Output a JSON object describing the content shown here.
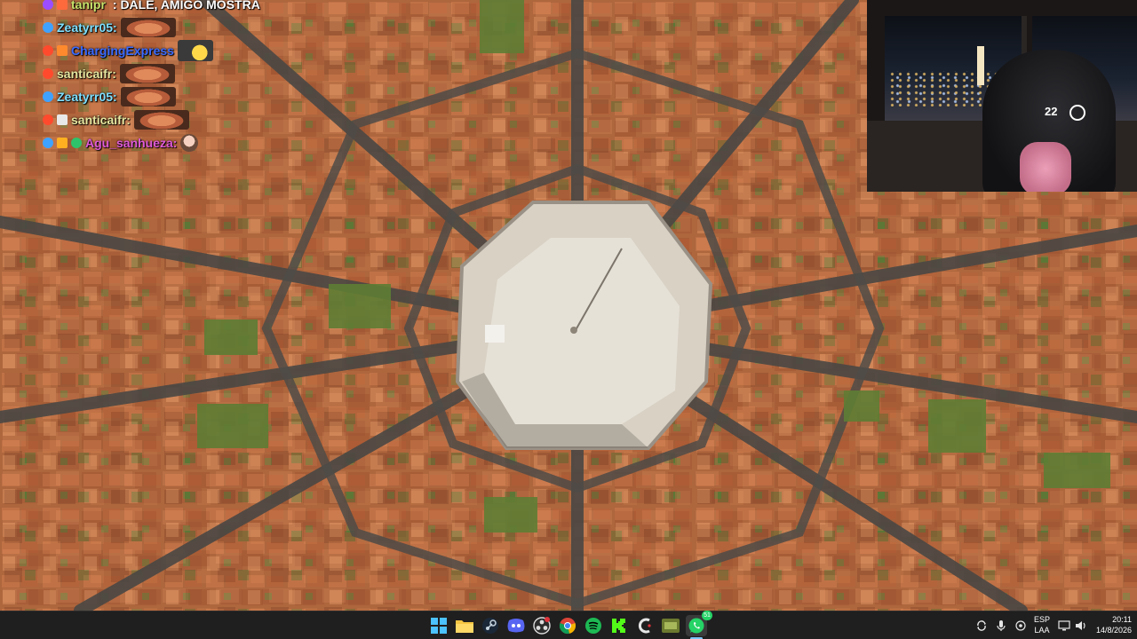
{
  "chat": {
    "messages": [
      {
        "user": "tanipr",
        "user_color": "#c7e36b",
        "message": ": DALE, AMIGO MOSTRA",
        "badges": [
          "#9b4dff",
          "#ff6a3d"
        ],
        "emote": "none"
      },
      {
        "user": "Zeatyrr05:",
        "user_color": "#7ee0ff",
        "message": "",
        "badges": [
          "#3fa2ff"
        ],
        "emote": "face"
      },
      {
        "user": "ChargingExpress",
        "user_color": "#3a6bff",
        "message": "",
        "badges": [
          "#ff4a2e",
          "#ff8a2e"
        ],
        "emote": "smiley"
      },
      {
        "user": "santicaifr:",
        "user_color": "#e7e7a0",
        "message": "",
        "badges": [
          "#ff4a2e"
        ],
        "emote": "face"
      },
      {
        "user": "Zeatyrr05:",
        "user_color": "#7ee0ff",
        "message": "",
        "badges": [
          "#3fa2ff"
        ],
        "emote": "face"
      },
      {
        "user": "santicaifr:",
        "user_color": "#e7e7a0",
        "message": "",
        "badges": [
          "#ff4a2e",
          "#e8e8e8"
        ],
        "emote": "face"
      },
      {
        "user": "Agu_sanhueza:",
        "user_color": "#e05ad8",
        "message": "",
        "badges": [
          "#3fa2ff",
          "#ffb020",
          "#2ec36a"
        ],
        "emote": "small"
      }
    ]
  },
  "webcam": {
    "cap_text": "22"
  },
  "taskbar": {
    "apps": [
      {
        "name": "start-button",
        "color": "#3aa0ff"
      },
      {
        "name": "file-explorer-icon",
        "color": "#f2c23a"
      },
      {
        "name": "steam-icon",
        "color": "#1b3a5c"
      },
      {
        "name": "discord-icon",
        "color": "#5865f2"
      },
      {
        "name": "obs-icon",
        "color": "#3a3a3a"
      },
      {
        "name": "chrome-icon",
        "color": "#e04a3a"
      },
      {
        "name": "spotify-icon",
        "color": "#1db954"
      },
      {
        "name": "kick-icon",
        "color": "#53fc18"
      },
      {
        "name": "ccleaner-icon",
        "color": "#d8d8d8"
      },
      {
        "name": "game-icon",
        "color": "#6a7a3a"
      },
      {
        "name": "whatsapp-icon",
        "color": "#25d366"
      }
    ],
    "whatsapp_badge": "51",
    "language_line1": "ESP",
    "language_line2": "LAA",
    "time": "20:11",
    "date": "14/8/2026"
  }
}
